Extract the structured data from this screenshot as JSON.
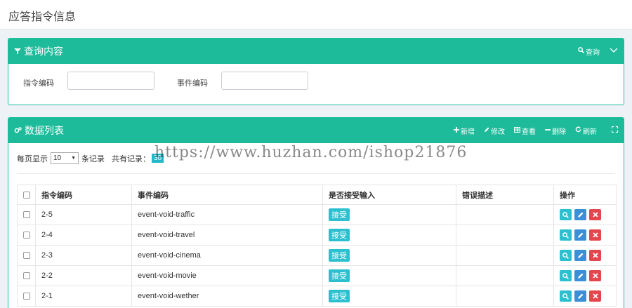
{
  "page": {
    "title": "应答指令信息"
  },
  "query_panel": {
    "title": "查询内容",
    "query_label": "查询",
    "fields": [
      {
        "label": "指令编码",
        "value": ""
      },
      {
        "label": "事件编码",
        "value": ""
      }
    ]
  },
  "data_panel": {
    "title": "数据列表",
    "actions": {
      "add": "新增",
      "edit": "修改",
      "view": "查看",
      "delete": "删除",
      "refresh": "刷新"
    },
    "pager": {
      "per_page_prefix": "每页显示",
      "per_page_value": "10",
      "per_page_suffix": "条记录",
      "total_prefix": "共有记录：",
      "total": "30"
    },
    "columns": [
      "指令编码",
      "事件编码",
      "是否接受输入",
      "错误描述",
      "操作"
    ],
    "rows": [
      {
        "code": "2-5",
        "event": "event-void-traffic",
        "accept": "接受",
        "error": ""
      },
      {
        "code": "2-4",
        "event": "event-void-travel",
        "accept": "接受",
        "error": ""
      },
      {
        "code": "2-3",
        "event": "event-void-cinema",
        "accept": "接受",
        "error": ""
      },
      {
        "code": "2-2",
        "event": "event-void-movie",
        "accept": "接受",
        "error": ""
      },
      {
        "code": "2-1",
        "event": "event-void-wether",
        "accept": "接受",
        "error": ""
      }
    ]
  },
  "watermark": "https://www.huzhan.com/ishop21876"
}
